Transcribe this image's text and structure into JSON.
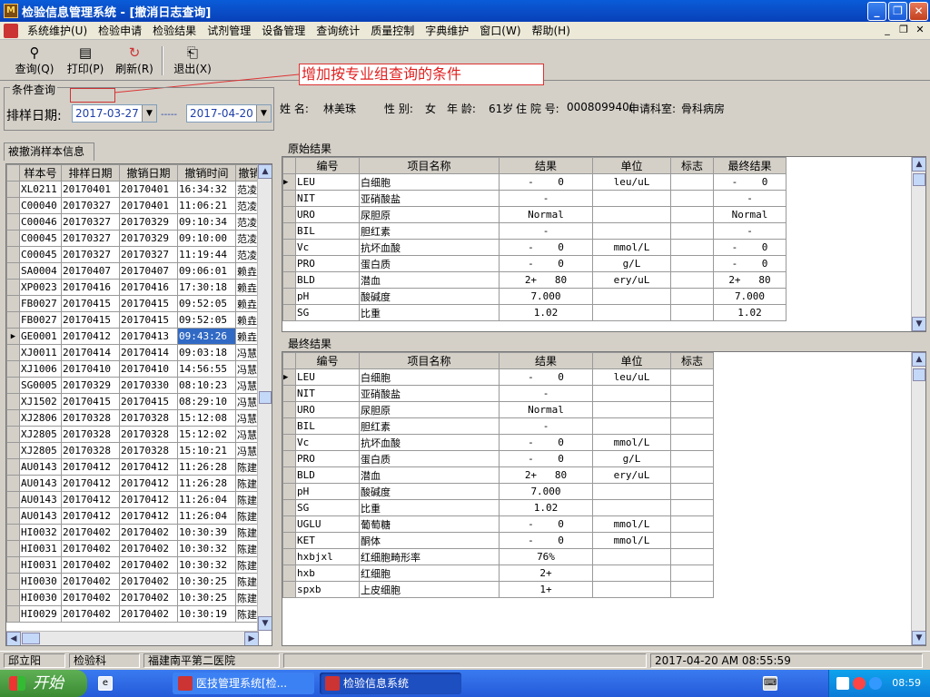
{
  "window": {
    "title": "检验信息管理系统 - [撤消日志查询]",
    "app_icon": "microscope-icon"
  },
  "menu": [
    "系统维护(U)",
    "检验申请",
    "检验结果",
    "试剂管理",
    "设备管理",
    "查询统计",
    "质量控制",
    "字典维护",
    "窗口(W)",
    "帮助(H)"
  ],
  "toolbar": {
    "query": "查询(Q)",
    "print": "打印(P)",
    "refresh": "刷新(R)",
    "exit": "退出(X)"
  },
  "annotation": "增加按专业组查询的条件",
  "conditions": {
    "legend": "条件查询",
    "date_label": "排样日期:",
    "date_from": "2017-03-27",
    "date_to": "2017-04-20",
    "dash": "-----"
  },
  "tab": "被撤消样本信息",
  "sample_grid": {
    "headers": [
      "样本号",
      "排样日期",
      "撤销日期",
      "撤销时间",
      "撤销"
    ],
    "rows": [
      [
        "XL0211",
        "20170401",
        "20170401",
        "16:34:32",
        "范凌"
      ],
      [
        "C00040",
        "20170327",
        "20170401",
        "11:06:21",
        "范凌"
      ],
      [
        "C00046",
        "20170327",
        "20170329",
        "09:10:34",
        "范凌"
      ],
      [
        "C00045",
        "20170327",
        "20170329",
        "09:10:00",
        "范凌"
      ],
      [
        "C00045",
        "20170327",
        "20170327",
        "11:19:44",
        "范凌"
      ],
      [
        "SA0004",
        "20170407",
        "20170407",
        "09:06:01",
        "赖垚"
      ],
      [
        "XP0023",
        "20170416",
        "20170416",
        "17:30:18",
        "赖垚"
      ],
      [
        "FB0027",
        "20170415",
        "20170415",
        "09:52:05",
        "赖垚"
      ],
      [
        "FB0027",
        "20170415",
        "20170415",
        "09:52:05",
        "赖垚"
      ],
      [
        "GE0001",
        "20170412",
        "20170413",
        "09:43:26",
        "赖垚"
      ],
      [
        "XJ0011",
        "20170414",
        "20170414",
        "09:03:18",
        "冯慧"
      ],
      [
        "XJ1006",
        "20170410",
        "20170410",
        "14:56:55",
        "冯慧"
      ],
      [
        "SG0005",
        "20170329",
        "20170330",
        "08:10:23",
        "冯慧"
      ],
      [
        "XJ1502",
        "20170415",
        "20170415",
        "08:29:10",
        "冯慧"
      ],
      [
        "XJ2806",
        "20170328",
        "20170328",
        "15:12:08",
        "冯慧"
      ],
      [
        "XJ2805",
        "20170328",
        "20170328",
        "15:12:02",
        "冯慧"
      ],
      [
        "XJ2805",
        "20170328",
        "20170328",
        "15:10:21",
        "冯慧"
      ],
      [
        "AU0143",
        "20170412",
        "20170412",
        "11:26:28",
        "陈建"
      ],
      [
        "AU0143",
        "20170412",
        "20170412",
        "11:26:28",
        "陈建"
      ],
      [
        "AU0143",
        "20170412",
        "20170412",
        "11:26:04",
        "陈建"
      ],
      [
        "AU0143",
        "20170412",
        "20170412",
        "11:26:04",
        "陈建"
      ],
      [
        "HI0032",
        "20170402",
        "20170402",
        "10:30:39",
        "陈建"
      ],
      [
        "HI0031",
        "20170402",
        "20170402",
        "10:30:32",
        "陈建"
      ],
      [
        "HI0031",
        "20170402",
        "20170402",
        "10:30:32",
        "陈建"
      ],
      [
        "HI0030",
        "20170402",
        "20170402",
        "10:30:25",
        "陈建"
      ],
      [
        "HI0030",
        "20170402",
        "20170402",
        "10:30:25",
        "陈建"
      ],
      [
        "HI0029",
        "20170402",
        "20170402",
        "10:30:19",
        "陈建"
      ]
    ]
  },
  "patient": {
    "name_label": "姓    名:",
    "name": "林美珠",
    "sex_label": "性  别:",
    "sex": "女",
    "age_label": "年  龄:",
    "age": "61岁",
    "bed_label": "住 院 号:",
    "bed": "000809940(",
    "dept_label": "申请科室:",
    "dept": "骨科病房"
  },
  "original": {
    "label": "原始结果",
    "headers": [
      "编号",
      "项目名称",
      "结果",
      "单位",
      "标志",
      "最终结果"
    ],
    "rows": [
      [
        "LEU",
        "白细胞",
        "-    0",
        "leu/uL",
        "",
        "-    0"
      ],
      [
        "NIT",
        "亚硝酸盐",
        "-",
        "",
        "",
        "-"
      ],
      [
        "URO",
        "尿胆原",
        "Normal",
        "",
        "",
        "Normal"
      ],
      [
        "BIL",
        "胆红素",
        "-",
        "",
        "",
        "-"
      ],
      [
        "Vc",
        "抗坏血酸",
        "-    0",
        "mmol/L",
        "",
        "-    0"
      ],
      [
        "PRO",
        "蛋白质",
        "-    0",
        "g/L",
        "",
        "-    0"
      ],
      [
        "BLD",
        "潜血",
        "2+   80",
        "ery/uL",
        "",
        "2+   80"
      ],
      [
        "pH",
        "酸碱度",
        "7.000",
        "",
        "",
        "7.000"
      ],
      [
        "SG",
        "比重",
        "1.02",
        "",
        "",
        "1.02"
      ]
    ]
  },
  "final": {
    "label": "最终结果",
    "headers": [
      "编号",
      "项目名称",
      "结果",
      "单位",
      "标志"
    ],
    "rows": [
      [
        "LEU",
        "白细胞",
        "-    0",
        "leu/uL",
        ""
      ],
      [
        "NIT",
        "亚硝酸盐",
        "-",
        "",
        ""
      ],
      [
        "URO",
        "尿胆原",
        "Normal",
        "",
        ""
      ],
      [
        "BIL",
        "胆红素",
        "-",
        "",
        ""
      ],
      [
        "Vc",
        "抗坏血酸",
        "-    0",
        "mmol/L",
        ""
      ],
      [
        "PRO",
        "蛋白质",
        "-    0",
        "g/L",
        ""
      ],
      [
        "BLD",
        "潜血",
        "2+   80",
        "ery/uL",
        ""
      ],
      [
        "pH",
        "酸碱度",
        "7.000",
        "",
        ""
      ],
      [
        "SG",
        "比重",
        "1.02",
        "",
        ""
      ],
      [
        "UGLU",
        "葡萄糖",
        "-    0",
        "mmol/L",
        ""
      ],
      [
        "KET",
        "酮体",
        "-    0",
        "mmol/L",
        ""
      ],
      [
        "hxbjxl",
        "红细胞畸形率",
        "76%",
        "",
        ""
      ],
      [
        "hxb",
        "红细胞",
        "2+",
        "",
        ""
      ],
      [
        "spxb",
        "上皮细胞",
        "1+",
        "",
        ""
      ]
    ]
  },
  "status": {
    "user": "邱立阳",
    "dept": "检验科",
    "hospital": "福建南平第二医院",
    "datetime": "2017-04-20  AM  08:55:59"
  },
  "taskbar": {
    "start": "开始",
    "task1": "医技管理系统[检...",
    "task2": "检验信息系统",
    "clock": "08:59"
  },
  "colors": {
    "titlebar": "#0a5cd8",
    "selection": "#316ac5",
    "annotation": "#e02020",
    "date_text": "#1f3fa8"
  }
}
